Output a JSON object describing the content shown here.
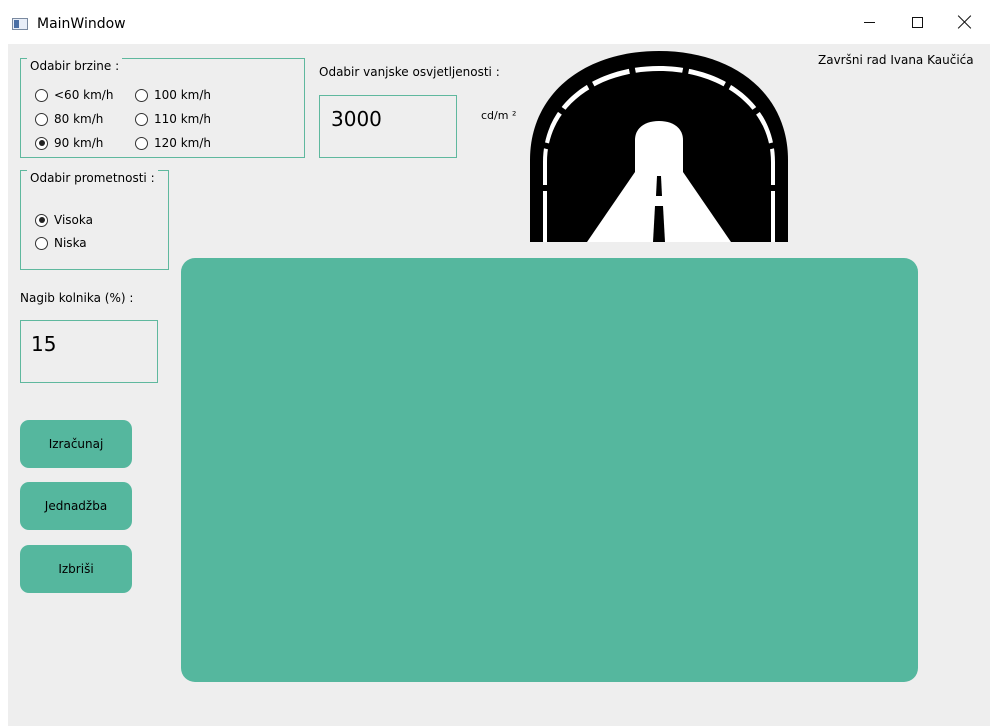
{
  "window": {
    "title": "MainWindow"
  },
  "author_label": "Završni rad Ivana Kaučića",
  "speed": {
    "title": "Odabir brzine :",
    "options": [
      {
        "label": "<60 km/h",
        "checked": false
      },
      {
        "label": "80 km/h",
        "checked": false
      },
      {
        "label": "90 km/h",
        "checked": true
      },
      {
        "label": "100 km/h",
        "checked": false
      },
      {
        "label": "110 km/h",
        "checked": false
      },
      {
        "label": "120 km/h",
        "checked": false
      }
    ]
  },
  "traffic": {
    "title": "Odabir prometnosti :",
    "options": [
      {
        "label": "Visoka",
        "checked": true
      },
      {
        "label": "Niska",
        "checked": false
      }
    ]
  },
  "luminance": {
    "label": "Odabir vanjske osvjetljenosti :",
    "value": "3000",
    "unit": "cd/m ²"
  },
  "slope": {
    "label": "Nagib kolnika (%) :",
    "value": "15"
  },
  "buttons": {
    "calculate": "Izračunaj",
    "equation": "Jednadžba",
    "clear": "Izbriši"
  },
  "colors": {
    "accent": "#55b79e",
    "border": "#5fb89e",
    "background": "#eeeeee"
  },
  "icons": {
    "tunnel": "tunnel-icon"
  }
}
